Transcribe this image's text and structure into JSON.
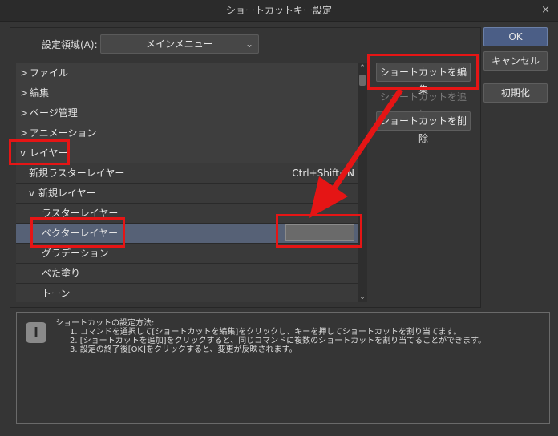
{
  "window": {
    "title": "ショートカットキー設定",
    "close_glyph": "×"
  },
  "region": {
    "label": "設定領域(A):",
    "value": "メインメニュー"
  },
  "tree": {
    "rows": [
      {
        "label": "ファイル",
        "twisty": ">",
        "indent": 0,
        "shortcut": ""
      },
      {
        "label": "編集",
        "twisty": ">",
        "indent": 0,
        "shortcut": ""
      },
      {
        "label": "ページ管理",
        "twisty": ">",
        "indent": 0,
        "shortcut": ""
      },
      {
        "label": "アニメーション",
        "twisty": ">",
        "indent": 0,
        "shortcut": ""
      },
      {
        "label": "レイヤー",
        "twisty": "v",
        "indent": 0,
        "shortcut": ""
      },
      {
        "label": "新規ラスターレイヤー",
        "twisty": "",
        "indent": 1,
        "shortcut": "Ctrl+Shift+N"
      },
      {
        "label": "新規レイヤー",
        "twisty": "v",
        "indent": 1,
        "shortcut": ""
      },
      {
        "label": "ラスターレイヤー",
        "twisty": "",
        "indent": 2,
        "shortcut": ""
      },
      {
        "label": "ベクターレイヤー",
        "twisty": "",
        "indent": 2,
        "shortcut": ""
      },
      {
        "label": "グラデーション",
        "twisty": "",
        "indent": 2,
        "shortcut": ""
      },
      {
        "label": "べた塗り",
        "twisty": "",
        "indent": 2,
        "shortcut": ""
      },
      {
        "label": "トーン",
        "twisty": "",
        "indent": 2,
        "shortcut": ""
      }
    ],
    "selected_index": 8
  },
  "actions": {
    "edit_shortcut": "ショートカットを編集",
    "add_shortcut": "ショートカットを追加",
    "delete_shortcut": "ショートカットを削除"
  },
  "dialog_buttons": {
    "ok": "OK",
    "cancel": "キャンセル",
    "reset": "初期化"
  },
  "info": {
    "heading": "ショートカットの設定方法:",
    "lines": [
      "1. コマンドを選択して[ショートカットを編集]をクリックし、キーを押してショートカットを割り当てます。",
      "2. [ショートカットを追加]をクリックすると、同じコマンドに複数のショートカットを割り当てることができます。",
      "3. 設定の終了後[OK]をクリックすると、変更が反映されます。"
    ]
  },
  "colors": {
    "highlight": "#e51515",
    "selection": "#566176",
    "primary_button": "#4b5e86"
  }
}
